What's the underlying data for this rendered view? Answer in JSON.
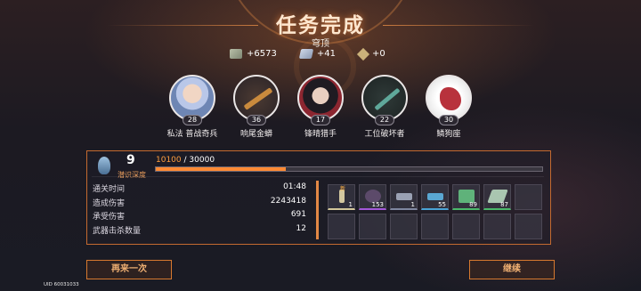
{
  "header": {
    "title": "任务完成",
    "location": "穹顶"
  },
  "rewards": [
    {
      "icon": "cash-icon",
      "value": "+6573"
    },
    {
      "icon": "alloy-bar-icon",
      "value": "+41"
    },
    {
      "icon": "crystal-icon",
      "value": "+0"
    }
  ],
  "party": [
    {
      "name": "私法 普战奇兵",
      "level": "28",
      "icon": "character-portrait"
    },
    {
      "name": "响尾金蟒",
      "level": "36",
      "icon": "rifle-weapon-portrait"
    },
    {
      "name": "锋晴猎手",
      "level": "17",
      "icon": "character-portrait"
    },
    {
      "name": "工位破坏者",
      "level": "22",
      "icon": "blade-weapon-portrait"
    },
    {
      "name": "鳞狗座",
      "level": "30",
      "icon": "beast-weapon-portrait"
    }
  ],
  "depth": {
    "level": "9",
    "label": "潜识深度",
    "progress_current": "10100",
    "progress_max": "/ 30000",
    "progress_fraction": 0.3367
  },
  "stats": [
    {
      "label": "通关时间",
      "value": "01:48"
    },
    {
      "label": "造成伤害",
      "value": "2243418"
    },
    {
      "label": "承受伤害",
      "value": "691"
    },
    {
      "label": "武器击杀数量",
      "value": "12"
    }
  ],
  "drops": [
    {
      "icon": "thermometer-icon",
      "count": "1",
      "new_label": "新",
      "color": "#d4c8a0"
    },
    {
      "icon": "tire-icon",
      "count": "153",
      "new_label": "",
      "color": "#5c4a6a"
    },
    {
      "icon": "pistol-icon",
      "count": "1",
      "new_label": "",
      "color": "#9aa1b3"
    },
    {
      "icon": "bullet-icon",
      "count": "55",
      "new_label": "",
      "color": "#5aa7d2"
    },
    {
      "icon": "armor-plate-icon",
      "count": "89",
      "new_label": "",
      "color": "#5fb27a"
    },
    {
      "icon": "metal-plate-icon",
      "count": "87",
      "new_label": "",
      "color": "#a9c6b0"
    }
  ],
  "buttons": {
    "retry": "再来一次",
    "continue": "继续"
  },
  "footer": {
    "uid": "UID 60031033"
  }
}
